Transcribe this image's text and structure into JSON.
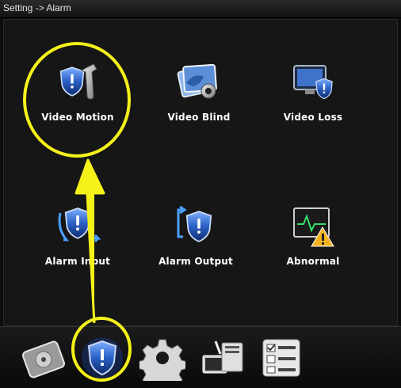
{
  "window": {
    "title": "Setting -> Alarm"
  },
  "colors": {
    "highlight": "#f5f21a",
    "shield": "#2a5fc4",
    "background": "#161616"
  },
  "tiles": [
    {
      "label": "Video Motion",
      "icon": "shield-wrench-icon"
    },
    {
      "label": "Video Blind",
      "icon": "camera-blind-icon"
    },
    {
      "label": "Video Loss",
      "icon": "monitor-shield-icon"
    },
    {
      "label": "Alarm Input",
      "icon": "shield-input-icon"
    },
    {
      "label": "Alarm Output",
      "icon": "shield-output-icon"
    },
    {
      "label": "Abnormal",
      "icon": "warning-monitor-icon"
    }
  ],
  "dock": [
    {
      "name": "hdd-icon"
    },
    {
      "name": "alarm-shield-icon",
      "selected": true
    },
    {
      "name": "gear-icon"
    },
    {
      "name": "network-icon"
    },
    {
      "name": "checklist-icon"
    }
  ]
}
